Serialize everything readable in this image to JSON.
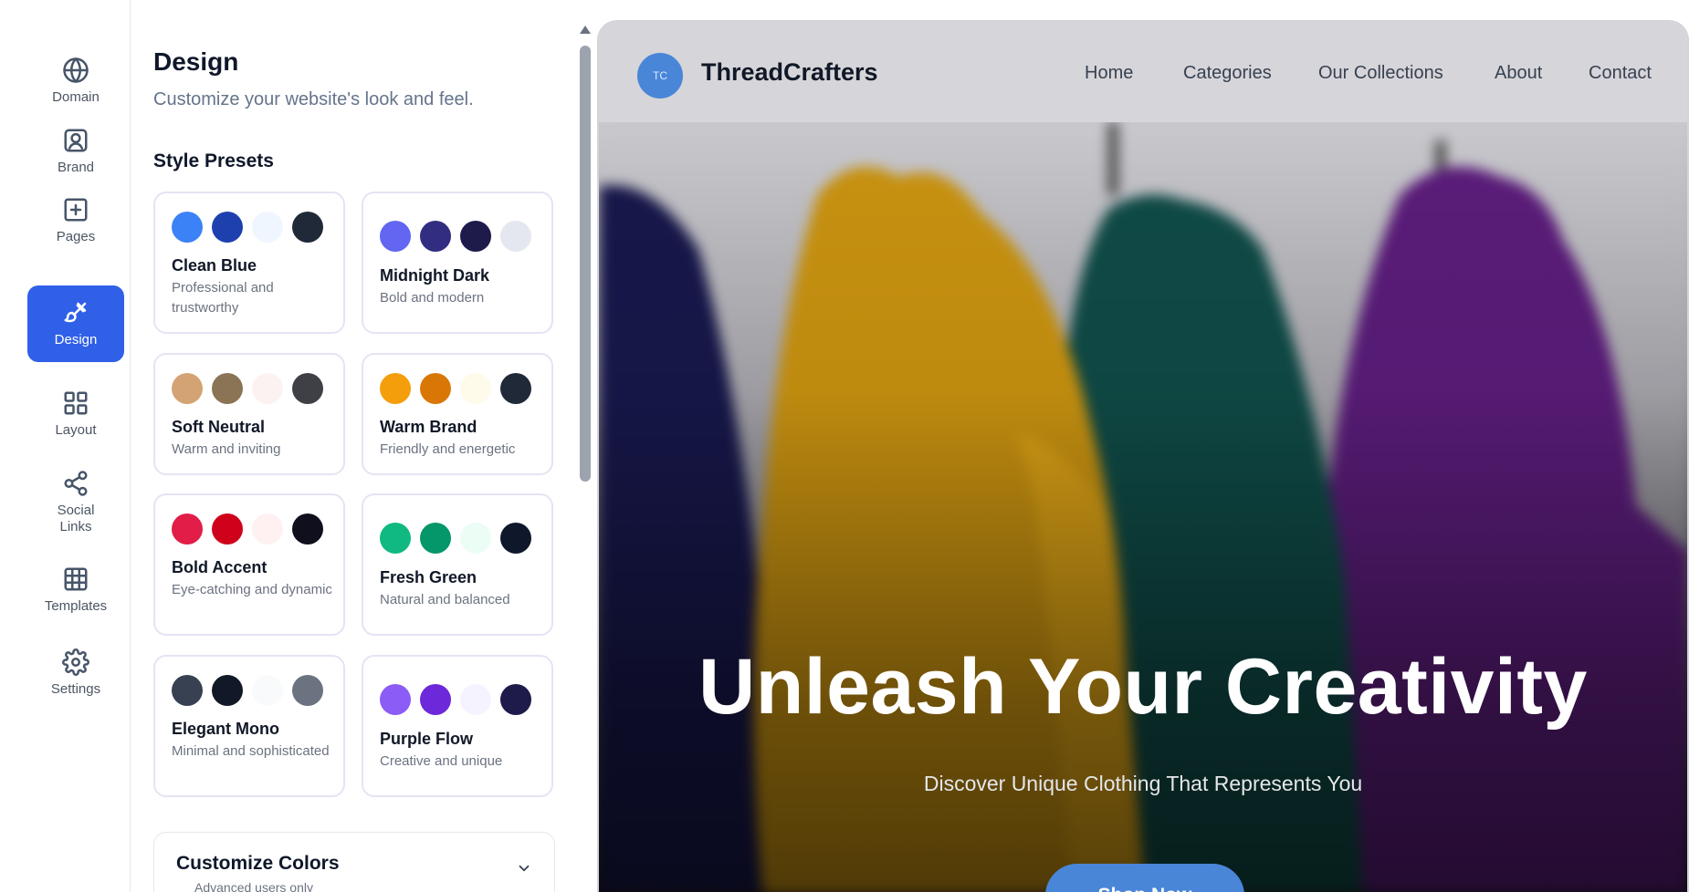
{
  "sidebar": {
    "items": [
      {
        "label": "Domain",
        "icon": "globe-icon"
      },
      {
        "label": "Brand",
        "icon": "user-square-icon"
      },
      {
        "label": "Pages",
        "icon": "plus-square-icon"
      },
      {
        "label": "Design",
        "icon": "paintbrush-icon",
        "active": true
      },
      {
        "label": "Layout",
        "icon": "grid-icon"
      },
      {
        "label": "Social Links",
        "icon": "share-icon"
      },
      {
        "label": "Templates",
        "icon": "table-icon"
      },
      {
        "label": "Settings",
        "icon": "gear-icon"
      }
    ]
  },
  "panel": {
    "title": "Design",
    "subtitle": "Customize your website's look and feel.",
    "presets_title": "Style Presets",
    "presets": [
      {
        "name": "Clean Blue",
        "desc": "Professional and trustworthy",
        "colors": [
          "#3b82f6",
          "#1e40af",
          "#eff6ff",
          "#1f2937"
        ]
      },
      {
        "name": "Midnight Dark",
        "desc": "Bold and modern",
        "colors": [
          "#6366f1",
          "#312e81",
          "#1e1b4b",
          "#e5e7f0"
        ]
      },
      {
        "name": "Soft Neutral",
        "desc": "Warm and inviting",
        "colors": [
          "#d4a373",
          "#8b7355",
          "#fdf2f2",
          "#3f3f46"
        ]
      },
      {
        "name": "Warm Brand",
        "desc": "Friendly and energetic",
        "colors": [
          "#f59e0b",
          "#d97706",
          "#fffbeb",
          "#1f2937"
        ]
      },
      {
        "name": "Bold Accent",
        "desc": "Eye-catching and dynamic",
        "colors": [
          "#e11d48",
          "#d0021b",
          "#fff1f2",
          "#0f0f1e"
        ]
      },
      {
        "name": "Fresh Green",
        "desc": "Natural and balanced",
        "colors": [
          "#10b981",
          "#059669",
          "#ecfdf5",
          "#0f172a"
        ]
      },
      {
        "name": "Elegant Mono",
        "desc": "Minimal and sophisticated",
        "colors": [
          "#374151",
          "#111827",
          "#f9fafb",
          "#6b7280"
        ]
      },
      {
        "name": "Purple Flow",
        "desc": "Creative and unique",
        "colors": [
          "#8b5cf6",
          "#6d28d9",
          "#f5f3ff",
          "#1e1b4b"
        ]
      }
    ],
    "customize": {
      "title": "Customize Colors",
      "subtitle": "Advanced users only"
    }
  },
  "preview": {
    "logo_initials": "TC",
    "brand": "ThreadCrafters",
    "nav": [
      "Home",
      "Categories",
      "Our Collections",
      "About",
      "Contact"
    ],
    "hero_title": "Unleash Your Creativity",
    "hero_subtitle": "Discover Unique Clothing That Represents You",
    "cta": "Shop Now",
    "accent": "#4a86d8"
  }
}
